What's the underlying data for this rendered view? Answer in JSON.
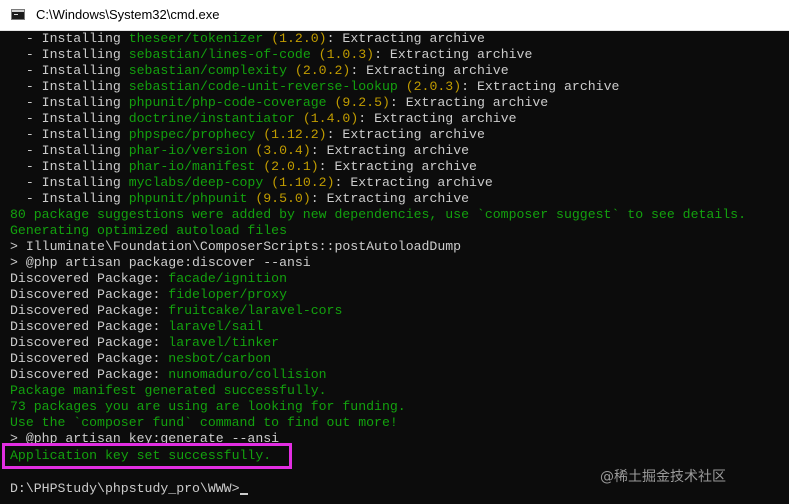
{
  "window": {
    "title": "C:\\Windows\\System32\\cmd.exe"
  },
  "colors": {
    "background": "#0c0c0c",
    "green": "#13a10e",
    "yellow": "#c19c00",
    "gray": "#cccccc",
    "highlight": "#e32ee3"
  },
  "console": {
    "install_prefix": "  - Installing ",
    "install_suffix": ": Extracting archive",
    "installs": [
      {
        "pkg": "theseer/tokenizer",
        "ver": "(1.2.0)"
      },
      {
        "pkg": "sebastian/lines-of-code",
        "ver": "(1.0.3)"
      },
      {
        "pkg": "sebastian/complexity",
        "ver": "(2.0.2)"
      },
      {
        "pkg": "sebastian/code-unit-reverse-lookup",
        "ver": "(2.0.3)"
      },
      {
        "pkg": "phpunit/php-code-coverage",
        "ver": "(9.2.5)"
      },
      {
        "pkg": "doctrine/instantiator",
        "ver": "(1.4.0)"
      },
      {
        "pkg": "phpspec/prophecy",
        "ver": "(1.12.2)"
      },
      {
        "pkg": "phar-io/version",
        "ver": "(3.0.4)"
      },
      {
        "pkg": "phar-io/manifest",
        "ver": "(2.0.1)"
      },
      {
        "pkg": "myclabs/deep-copy",
        "ver": "(1.10.2)"
      },
      {
        "pkg": "phpunit/phpunit",
        "ver": "(9.5.0)"
      }
    ],
    "suggestions": "80 package suggestions were added by new dependencies, use `composer suggest` to see details.",
    "autoload": "Generating optimized autoload files",
    "post_autoload": "> Illuminate\\Foundation\\ComposerScripts::postAutoloadDump",
    "discover_cmd": "> @php artisan package:discover --ansi",
    "discovered_prefix": "Discovered Package: ",
    "discovered": [
      "facade/ignition",
      "fideloper/proxy",
      "fruitcake/laravel-cors",
      "laravel/sail",
      "laravel/tinker",
      "nesbot/carbon",
      "nunomaduro/collision"
    ],
    "manifest": "Package manifest generated successfully.",
    "funding": "73 packages you are using are looking for funding.",
    "fund_hint": "Use the `composer fund` command to find out more!",
    "key_cmd": "> @php artisan key:generate --ansi",
    "key_set": "Application key set successfully.",
    "prompt": "D:\\PHPStudy\\phpstudy_pro\\WWW>"
  },
  "watermark": "@稀土掘金技术社区"
}
